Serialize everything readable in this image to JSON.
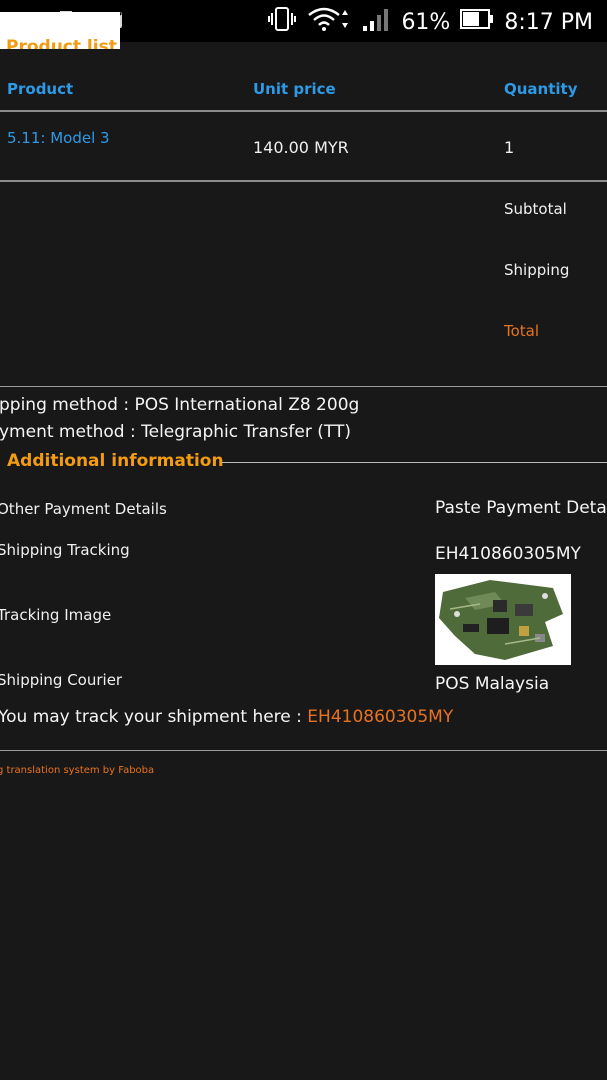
{
  "status_bar": {
    "battery": "61%",
    "time": "8:17 PM",
    "icons": [
      "gmail-icon",
      "outlook-icon",
      "gmail-icon",
      "vibrate-icon",
      "wifi-icon",
      "signal-icon",
      "battery-icon"
    ]
  },
  "section": {
    "title": "Product list"
  },
  "table": {
    "headers": {
      "product": "Product",
      "unit_price": "Unit price",
      "quantity": "Quantity"
    },
    "rows": [
      {
        "product": "5.11: Model 3",
        "unit_price": "140.00 MYR",
        "quantity": "1"
      }
    ]
  },
  "summary": {
    "subtotal": "Subtotal",
    "shipping": "Shipping",
    "total": "Total"
  },
  "methods": {
    "shipping": "pping method : POS International Z8 200g",
    "payment": "yment method : Telegraphic Transfer (TT)"
  },
  "additional": {
    "title": "Additional information",
    "fields": [
      {
        "label": "Other Payment Details",
        "value": "Paste Payment Deta"
      },
      {
        "label": "Shipping Tracking",
        "value": "EH410860305MY"
      },
      {
        "label": "Tracking Image",
        "value": ""
      },
      {
        "label": "Shipping Courier",
        "value": "POS Malaysia"
      }
    ],
    "track_text": "You may track your shipment here : ",
    "track_link": "EH410860305MY"
  },
  "footer": "g translation system by Faboba",
  "colors": {
    "background": "#181818",
    "accent_orange": "#f39c12",
    "link_blue": "#2e9ae6",
    "link_orange": "#e8731e"
  }
}
